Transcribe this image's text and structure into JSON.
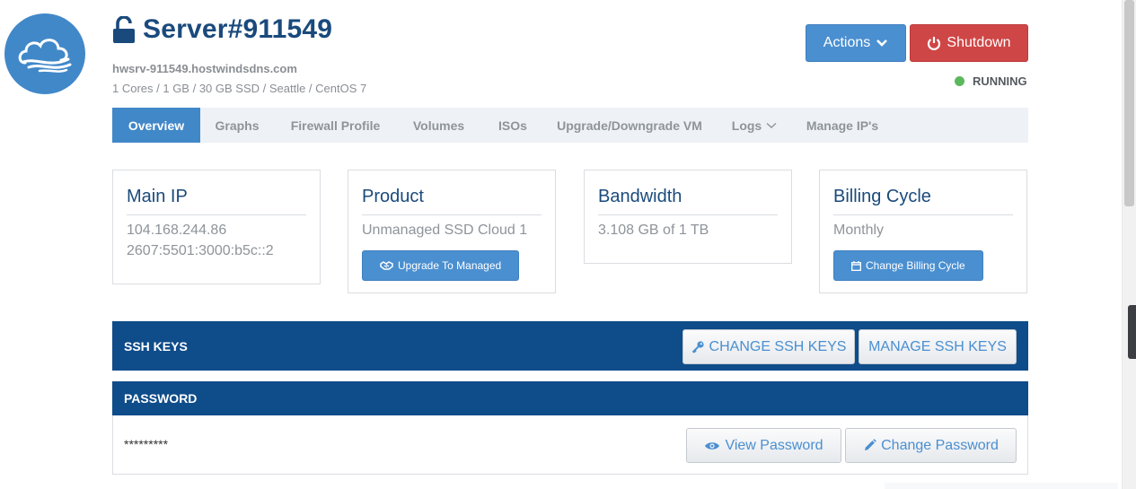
{
  "header": {
    "title": "Server#911549",
    "hostname": "hwsrv-911549.hostwindsdns.com",
    "specs": "1 Cores / 1 GB / 30 GB SSD / Seattle / CentOS 7",
    "actions_label": "Actions",
    "shutdown_label": "Shutdown",
    "status": "RUNNING"
  },
  "tabs": [
    {
      "label": "Overview",
      "active": true
    },
    {
      "label": "Graphs"
    },
    {
      "label": "Firewall Profile"
    },
    {
      "label": "Volumes"
    },
    {
      "label": "ISOs"
    },
    {
      "label": "Upgrade/Downgrade VM"
    },
    {
      "label": "Logs"
    },
    {
      "label": "Manage IP's"
    }
  ],
  "cards": {
    "main_ip": {
      "title": "Main IP",
      "ipv4": "104.168.244.86",
      "ipv6": "2607:5501:3000:b5c::2"
    },
    "product": {
      "title": "Product",
      "value": "Unmanaged SSD Cloud 1",
      "button": "Upgrade To Managed"
    },
    "bandwidth": {
      "title": "Bandwidth",
      "value": "3.108 GB of 1 TB"
    },
    "billing": {
      "title": "Billing Cycle",
      "value": "Monthly",
      "button": "Change Billing Cycle"
    }
  },
  "ssh": {
    "title": "SSH KEYS",
    "change_label": "CHANGE SSH KEYS",
    "manage_label": "MANAGE SSH KEYS"
  },
  "password": {
    "title": "PASSWORD",
    "mask": "*********",
    "view_label": "View Password",
    "change_label": "Change Password"
  },
  "colors": {
    "brand_blue": "#4188c9",
    "panel_navy": "#0f4c8a",
    "danger_red": "#cf4646",
    "status_green": "#5cb85c"
  },
  "icons": [
    "cloud-logo-icon",
    "unlock-icon",
    "chevron-down-icon",
    "power-icon",
    "status-dot-icon",
    "handshake-icon",
    "calendar-icon",
    "key-icon",
    "eye-icon",
    "pencil-icon"
  ]
}
